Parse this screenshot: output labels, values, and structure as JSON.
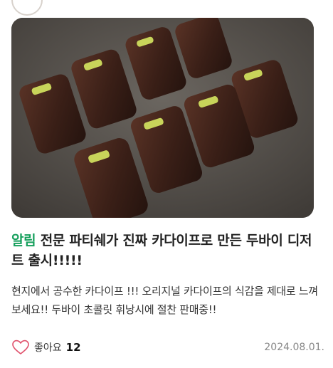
{
  "post": {
    "title_tag": "알림",
    "title_text": " 전문 파티쉐가 진짜 카다이프로 만든 두바이 디저트 출시!!!!!",
    "description": "현지에서 공수한 카다이프 !!! 오리지널 카다이프의 식감을 제대로 느껴보세요!! 두바이 초콜릿 휘낭시에 절찬 판매중!!",
    "like_label": "좋아요",
    "like_count": "12",
    "date": "2024.08.01.",
    "photo_alt": "chocolate-covered kadayif desserts with pistachio"
  },
  "icons": {
    "like": "heart-outline-icon"
  },
  "colors": {
    "tag": "#17a05d",
    "heart": "#e0506b",
    "date": "#888888"
  }
}
